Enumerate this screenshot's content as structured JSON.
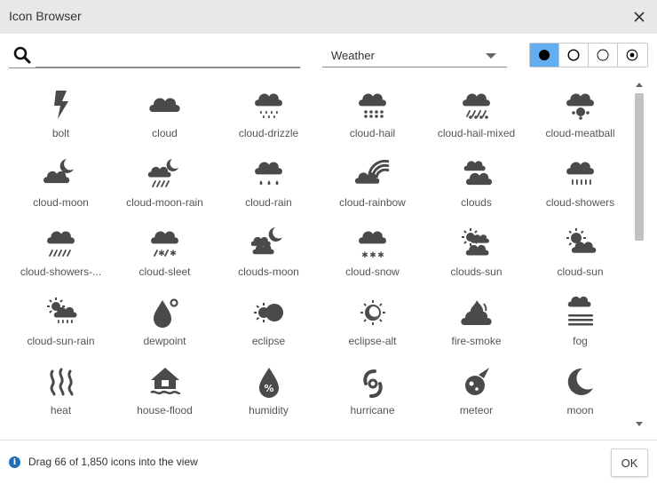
{
  "window": {
    "title": "Icon Browser",
    "close_icon": "close-icon"
  },
  "search": {
    "value": "",
    "placeholder": "",
    "icon": "search-icon"
  },
  "category": {
    "selected": "Weather"
  },
  "style_toggle": {
    "options": [
      "solid",
      "regular",
      "light",
      "duotone"
    ],
    "selected": "solid",
    "accent": "#63aef0"
  },
  "icons": [
    {
      "label": "bolt",
      "icon": "bolt-icon"
    },
    {
      "label": "cloud",
      "icon": "cloud-icon"
    },
    {
      "label": "cloud-drizzle",
      "icon": "cloud-drizzle-icon"
    },
    {
      "label": "cloud-hail",
      "icon": "cloud-hail-icon"
    },
    {
      "label": "cloud-hail-mixed",
      "icon": "cloud-hail-mixed-icon"
    },
    {
      "label": "cloud-meatball",
      "icon": "cloud-meatball-icon"
    },
    {
      "label": "cloud-moon",
      "icon": "cloud-moon-icon"
    },
    {
      "label": "cloud-moon-rain",
      "icon": "cloud-moon-rain-icon"
    },
    {
      "label": "cloud-rain",
      "icon": "cloud-rain-icon"
    },
    {
      "label": "cloud-rainbow",
      "icon": "cloud-rainbow-icon"
    },
    {
      "label": "clouds",
      "icon": "clouds-icon"
    },
    {
      "label": "cloud-showers",
      "icon": "cloud-showers-icon"
    },
    {
      "label": "cloud-showers-...",
      "icon": "cloud-showers-heavy-icon"
    },
    {
      "label": "cloud-sleet",
      "icon": "cloud-sleet-icon"
    },
    {
      "label": "clouds-moon",
      "icon": "clouds-moon-icon"
    },
    {
      "label": "cloud-snow",
      "icon": "cloud-snow-icon"
    },
    {
      "label": "clouds-sun",
      "icon": "clouds-sun-icon"
    },
    {
      "label": "cloud-sun",
      "icon": "cloud-sun-icon"
    },
    {
      "label": "cloud-sun-rain",
      "icon": "cloud-sun-rain-icon"
    },
    {
      "label": "dewpoint",
      "icon": "dewpoint-icon"
    },
    {
      "label": "eclipse",
      "icon": "eclipse-icon"
    },
    {
      "label": "eclipse-alt",
      "icon": "eclipse-alt-icon"
    },
    {
      "label": "fire-smoke",
      "icon": "fire-smoke-icon"
    },
    {
      "label": "fog",
      "icon": "fog-icon"
    },
    {
      "label": "heat",
      "icon": "heat-icon"
    },
    {
      "label": "house-flood",
      "icon": "house-flood-icon"
    },
    {
      "label": "humidity",
      "icon": "humidity-icon"
    },
    {
      "label": "hurricane",
      "icon": "hurricane-icon"
    },
    {
      "label": "meteor",
      "icon": "meteor-icon"
    },
    {
      "label": "moon",
      "icon": "moon-icon"
    }
  ],
  "icon_color": "#4a4a4a",
  "status": {
    "text": "Drag 66 of 1,850 icons into the view",
    "icon": "info-icon"
  },
  "footer": {
    "ok_label": "OK"
  }
}
